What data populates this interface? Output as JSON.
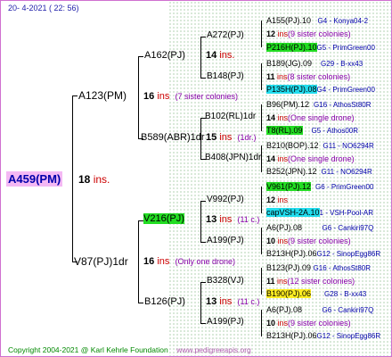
{
  "header": "20-  4-2021 ( 22: 56)",
  "footer": {
    "copyright": "Copyright 2004-2021 @ Karl Kehrle Foundation",
    "url": "www.pedigreeapis.org"
  },
  "root": {
    "name": "A459(PM)",
    "count": "18",
    "ins": "ins."
  },
  "g1": [
    {
      "name": "A123(PM)"
    },
    {
      "name": "V87(PJ)1dr"
    }
  ],
  "g1_notes": [
    {
      "count": "16",
      "ins": "ins",
      "note": "(7 sister colonies)"
    },
    {
      "count": "16",
      "ins": "ins",
      "note": "(Only one drone)"
    }
  ],
  "g2": [
    {
      "name": "A162(PJ)",
      "count": "14",
      "ins": "ins.",
      "note": ""
    },
    {
      "name": "B589(ABR)1dr",
      "count": "15",
      "ins": "ins",
      "note": "(1dr.)"
    },
    {
      "name": "V216(PJ)",
      "count": "13",
      "ins": "ins",
      "note": "(11 c.)"
    },
    {
      "name": "B126(PJ)",
      "count": "13",
      "ins": "ins",
      "note": "(11 c.)"
    }
  ],
  "g3": [
    {
      "name": "A272(PJ)"
    },
    {
      "name": "B148(PJ)"
    },
    {
      "name": "B102(RL)1dr"
    },
    {
      "name": "B408(JPN)1dr"
    },
    {
      "name": "V992(PJ)"
    },
    {
      "name": "A199(PJ)"
    },
    {
      "name": "B328(VJ)"
    },
    {
      "name": "A199(PJ)"
    }
  ],
  "g4": [
    {
      "name": "A155(PJ).10",
      "src": "G4 - Konya04-2"
    },
    {
      "count": "12",
      "ins": "ins",
      "note": "(9 sister colonies)"
    },
    {
      "name": "P216H(PJ).10",
      "src": "G5 - PrimGreen00"
    },
    {
      "name": "B189(JG).09",
      "src": "G29 - B-xx43"
    },
    {
      "count": "11",
      "ins": "ins",
      "note": "(8 sister colonies)"
    },
    {
      "name": "P135H(PJ).08",
      "src": "G4 - PrimGreen00"
    },
    {
      "name": "B96(PM).12",
      "src": "G16 - AthosSt80R"
    },
    {
      "count": "14",
      "ins": "ins",
      "note": "(One single drone)"
    },
    {
      "name": "T8(RL).09",
      "src": "G5 - Athos00R"
    },
    {
      "name": "B210(BOP).12",
      "src": "G11 - NO6294R"
    },
    {
      "count": "14",
      "ins": "ins",
      "note": "(One single drone)"
    },
    {
      "name": "B252(JPN).12",
      "src": "G11 - NO6294R"
    },
    {
      "name": "V961(PJ).12",
      "src": "G6 - PrimGreen00"
    },
    {
      "count": "12",
      "ins": "ins",
      "note": ""
    },
    {
      "name": "capVSH-2A.10",
      "src": "1 - VSH-Pool-AR"
    },
    {
      "name": "A6(PJ).08",
      "src": "G6 - Cankiri97Q"
    },
    {
      "count": "10",
      "ins": "ins",
      "note": "(9 sister colonies)"
    },
    {
      "name": "B213H(PJ).06",
      "src": "G12 - SinopEgg86R"
    },
    {
      "name": "B123(PJ).09",
      "src": "G16 - AthosSt80R"
    },
    {
      "count": "11",
      "ins": "ins",
      "note": "(12 sister colonies)"
    },
    {
      "name": "B190(PJ).06",
      "src": "G28 - B-xx43"
    },
    {
      "name": "A6(PJ).08",
      "src": "G6 - Cankiri97Q"
    },
    {
      "count": "10",
      "ins": "ins",
      "note": "(9 sister colonies)"
    },
    {
      "name": "B213H(PJ).06",
      "src": "G12 - SinopEgg86R"
    }
  ]
}
